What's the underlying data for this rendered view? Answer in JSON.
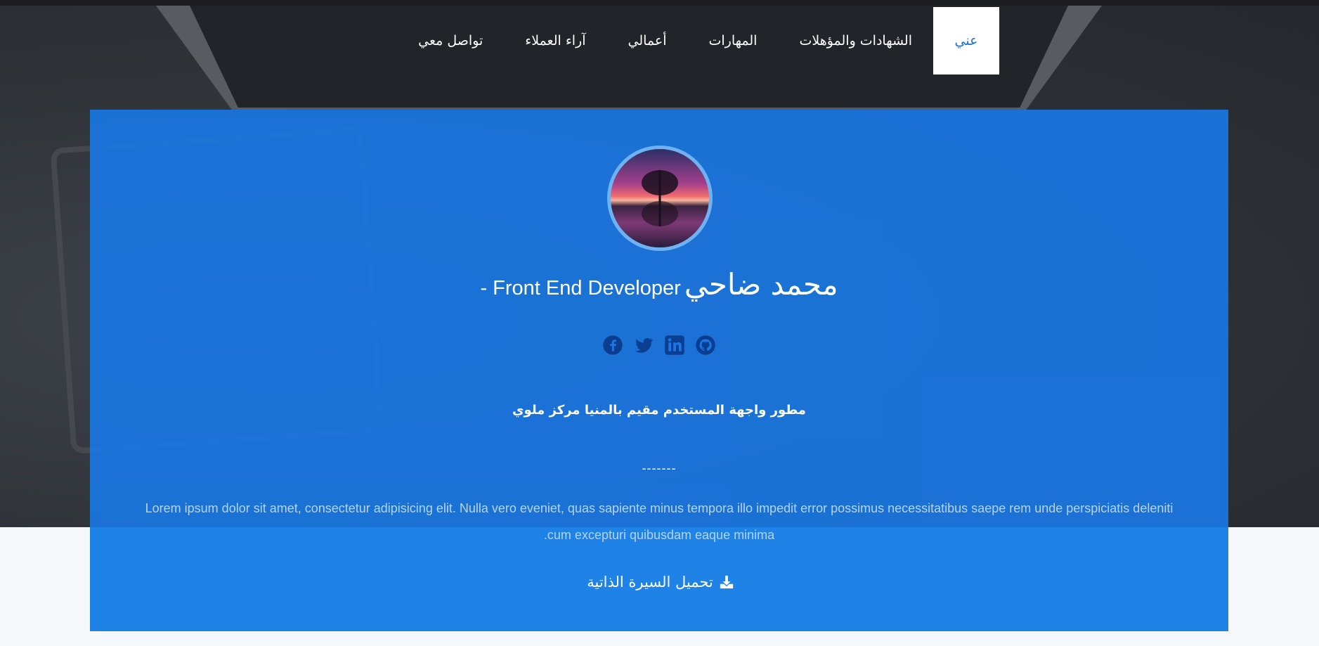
{
  "nav": {
    "items": [
      {
        "label": "عني",
        "active": true
      },
      {
        "label": "الشهادات والمؤهلات",
        "active": false
      },
      {
        "label": "المهارات",
        "active": false
      },
      {
        "label": "أعمالي",
        "active": false
      },
      {
        "label": "آراء العملاء",
        "active": false
      },
      {
        "label": "تواصل معي",
        "active": false
      }
    ]
  },
  "profile": {
    "name": "محمد ضاحي",
    "role": "Front End Developer -",
    "tagline": "مطور واجهة المستخدم مقيم بالمنيا مركز ملوي",
    "divider": "-------",
    "bio": "Lorem ipsum dolor sit amet, consectetur adipisicing elit. Nulla vero eveniet, quas sapiente minus tempora illo impedit error possimus necessitatibus saepe rem unde perspiciatis deleniti cum excepturi quibusdam eaque minima."
  },
  "socials": [
    {
      "icon": "github-icon"
    },
    {
      "icon": "linkedin-icon"
    },
    {
      "icon": "twitter-icon"
    },
    {
      "icon": "facebook-icon"
    }
  ],
  "cv": {
    "label": "تحميل السيرة الذاتية",
    "icon": "download-icon"
  },
  "colors": {
    "accent": "#1a73d9",
    "card": "#1878e6",
    "nav_bg": "#212529",
    "social_icon": "#0b3d91"
  }
}
